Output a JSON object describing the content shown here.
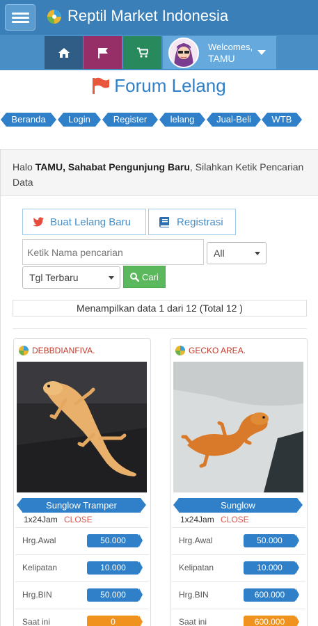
{
  "app": {
    "title": "Reptil Market Indonesia"
  },
  "nav": {
    "welcome": "Welcomes,",
    "user": "TAMU"
  },
  "page": {
    "title": "Forum Lelang"
  },
  "breadcrumbs": [
    "Beranda",
    "Login",
    "Register",
    "lelang",
    "Jual-Beli",
    "WTB"
  ],
  "greeting": {
    "prefix": "Halo ",
    "bold": "TAMU, Sahabat Pengunjung Baru",
    "suffix": ", Silahkan Ketik Pencarian Data"
  },
  "actions": {
    "new_auction": "Buat Lelang Baru",
    "register": "Registrasi"
  },
  "search": {
    "placeholder": "Ketik Nama pencarian",
    "category": "All",
    "sort": "Tgl Terbaru",
    "button": "Cari"
  },
  "results": {
    "summary": "Menampilkan data 1 dari 12 (Total 12 )"
  },
  "labels": {
    "start": "Hrg.Awal",
    "step": "Kelipatan",
    "bin": "Hrg.BIN",
    "now": "Saat ini"
  },
  "items": [
    {
      "seller": "DEBBDIANFIVA.",
      "name": "Sunglow Tramper",
      "duration": "1x24Jam",
      "status": "CLOSE",
      "start": "50.000",
      "step": "10.000",
      "bin": "50.000",
      "now": "0"
    },
    {
      "seller": "GECKO AREA.",
      "name": "Sunglow",
      "duration": "1x24Jam",
      "status": "CLOSE",
      "start": "50.000",
      "step": "10.000",
      "bin": "600.000",
      "now": "600.000"
    }
  ],
  "colors": {
    "primary": "#2f80c8",
    "header": "#3a7fb8",
    "home_tile": "#2f5d85",
    "flag_tile": "#962f68",
    "cart_tile": "#28895c",
    "accent_orange": "#f0931e",
    "status_red": "#d9534f"
  }
}
